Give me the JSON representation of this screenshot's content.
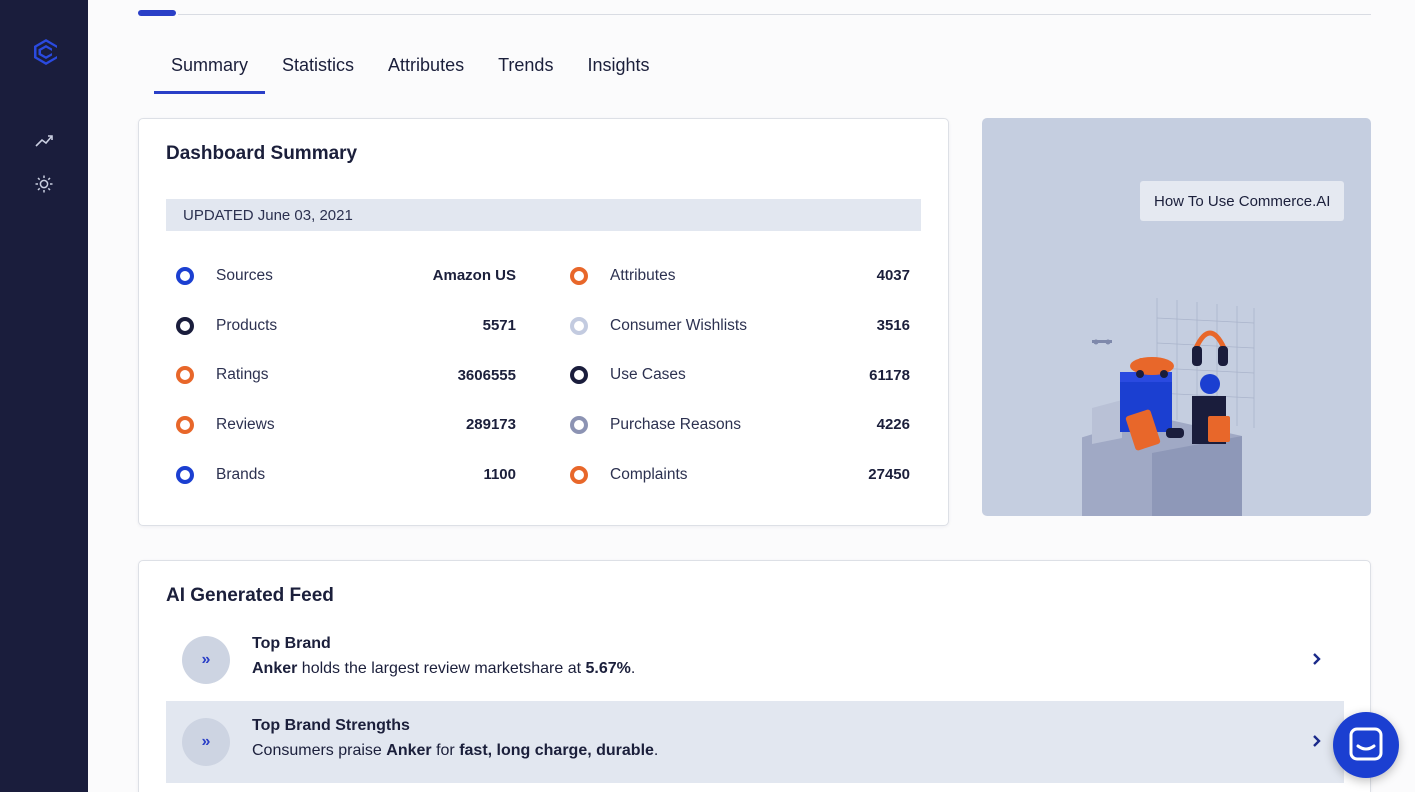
{
  "tabs": [
    {
      "label": "Summary"
    },
    {
      "label": "Statistics"
    },
    {
      "label": "Attributes"
    },
    {
      "label": "Trends"
    },
    {
      "label": "Insights"
    }
  ],
  "summary": {
    "title": "Dashboard Summary",
    "updated": "UPDATED June 03, 2021",
    "left": [
      {
        "label": "Sources",
        "value": "Amazon US",
        "color": "#1b3fd1"
      },
      {
        "label": "Products",
        "value": "5571",
        "color": "#1a1d3c"
      },
      {
        "label": "Ratings",
        "value": "3606555",
        "color": "#e8672a"
      },
      {
        "label": "Reviews",
        "value": "289173",
        "color": "#e8672a"
      },
      {
        "label": "Brands",
        "value": "1100",
        "color": "#1b3fd1"
      }
    ],
    "right": [
      {
        "label": "Attributes",
        "value": "4037",
        "color": "#e8672a"
      },
      {
        "label": "Consumer Wishlists",
        "value": "3516",
        "color": "#c3cbe0"
      },
      {
        "label": "Use Cases",
        "value": "61178",
        "color": "#1a1d3c"
      },
      {
        "label": "Purchase Reasons",
        "value": "4226",
        "color": "#8c93b3"
      },
      {
        "label": "Complaints",
        "value": "27450",
        "color": "#e8672a"
      }
    ]
  },
  "promo": {
    "button_label": "How To Use Commerce.AI"
  },
  "feed": {
    "title": "AI Generated Feed",
    "items": [
      {
        "heading": "Top Brand",
        "p1": "Anker",
        "p2": " holds the largest review marketshare at ",
        "p3": "5.67%",
        "p4": "."
      },
      {
        "heading": "Top Brand Strengths",
        "p1": "Consumers praise ",
        "p2": "Anker",
        "p3": " for ",
        "p4": "fast, long charge, durable",
        "p5": "."
      }
    ]
  },
  "icons": {
    "logo": "commerce-ai-logo",
    "nav": [
      "trending-icon",
      "sun-icon"
    ],
    "feed": "double-chevron-right-icon",
    "arrow": "chevron-right-icon",
    "chat": "chat-icon"
  },
  "colors": {
    "sidebar": "#1a1d3c",
    "accent": "#2a3fc7",
    "orange": "#e8672a",
    "highlight": "#e2e7f0"
  }
}
